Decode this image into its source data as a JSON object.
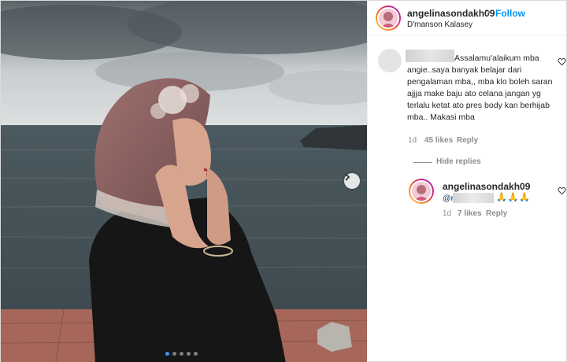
{
  "post": {
    "username": "angelinasondakh09",
    "bullet": "•",
    "follow_label": "Follow",
    "location": "D'manson Kalasey",
    "carousel": {
      "count": 5,
      "active_index": 0
    }
  },
  "comment": {
    "text": "Assalamu'alaikum mba angie..saya banyak belajar dari pengalaman mba,, mba klo boleh saran ajjja make baju ato celana jangan yg terlalu ketat ato pres body kan berhijab mba.. Makasi mba",
    "age": "1d",
    "likes": "45 likes",
    "reply_label": "Reply",
    "hide_replies_label": "Hide replies"
  },
  "reply": {
    "username": "angelinasondakh09",
    "mention_prefix": "@ri",
    "emoji": "🙏🙏🙏",
    "age": "1d",
    "likes": "7 likes",
    "reply_label": "Reply"
  },
  "colors": {
    "follow": "#0095f6",
    "muted": "#8e8e8e",
    "text": "#262626"
  },
  "icons": [
    "heart-outline-icon",
    "chevron-right-icon"
  ]
}
